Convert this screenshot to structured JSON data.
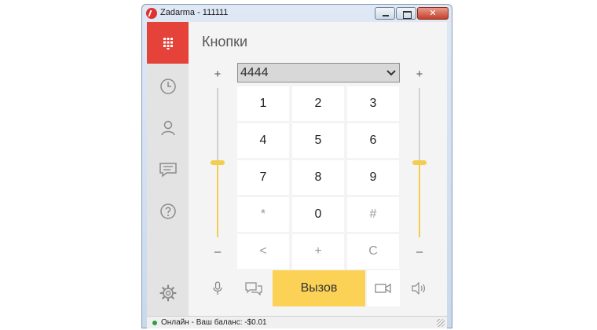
{
  "window": {
    "title": "Zadarma - 111111"
  },
  "sidebar": {
    "items": [
      {
        "name": "keypad",
        "icon": "dialpad-icon",
        "active": true
      },
      {
        "name": "history",
        "icon": "clock-icon",
        "active": false
      },
      {
        "name": "contacts",
        "icon": "person-icon",
        "active": false
      },
      {
        "name": "messages",
        "icon": "chat-icon",
        "active": false
      },
      {
        "name": "help",
        "icon": "help-icon",
        "active": false
      },
      {
        "name": "settings",
        "icon": "gear-icon",
        "active": false
      }
    ]
  },
  "main": {
    "title": "Кнопки",
    "number_select": {
      "value": "4444"
    },
    "mic_volume": {
      "plus": "+",
      "minus": "–",
      "level": 0.5
    },
    "speaker_volume": {
      "plus": "+",
      "minus": "–",
      "level": 0.5
    },
    "keys": [
      {
        "label": "1",
        "muted": false
      },
      {
        "label": "2",
        "muted": false
      },
      {
        "label": "3",
        "muted": false
      },
      {
        "label": "4",
        "muted": false
      },
      {
        "label": "5",
        "muted": false
      },
      {
        "label": "6",
        "muted": false
      },
      {
        "label": "7",
        "muted": false
      },
      {
        "label": "8",
        "muted": false
      },
      {
        "label": "9",
        "muted": false
      },
      {
        "label": "*",
        "muted": true
      },
      {
        "label": "0",
        "muted": false
      },
      {
        "label": "#",
        "muted": true
      },
      {
        "label": "<",
        "muted": true
      },
      {
        "label": "+",
        "muted": true
      },
      {
        "label": "C",
        "muted": true
      }
    ],
    "call_button": "Вызов"
  },
  "status": {
    "text": "Онлайн - Ваш баланс: -$0.01",
    "color": "#2ea043"
  },
  "colors": {
    "accent_red": "#e5433a",
    "accent_yellow": "#fbd256",
    "slider_yellow": "#f2cd4e"
  }
}
